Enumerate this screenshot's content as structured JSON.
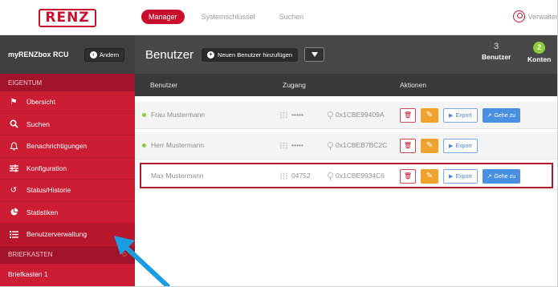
{
  "app": {
    "logo": "RENZ"
  },
  "nav": {
    "items": [
      "Manager",
      "Systemschlüssel",
      "Suchen"
    ],
    "active_index": 0,
    "user_label": "Verwalter"
  },
  "sidebar": {
    "box_title": "myRENZbox RCU",
    "change_label": "Ändern",
    "section_property": "EIGENTUM",
    "items": [
      {
        "label": "Übersicht",
        "icon": "flag-icon"
      },
      {
        "label": "Suchen",
        "icon": "search-icon"
      },
      {
        "label": "Benachrichtigungen",
        "icon": "bell-icon"
      },
      {
        "label": "Konfiguration",
        "icon": "sliders-icon"
      },
      {
        "label": "Status/Historie",
        "icon": "history-icon"
      },
      {
        "label": "Statistiken",
        "icon": "pie-chart-icon"
      },
      {
        "label": "Benutzerverwaltung",
        "icon": "list-icon"
      }
    ],
    "active_index": 6,
    "section_mailbox": "BRIEFKASTEN",
    "mailbox_item": "Briefkasten 1"
  },
  "header": {
    "title": "Benutzer",
    "add_label": "Neuen Benutzer hinzufügen",
    "stats": [
      {
        "value": "3",
        "label": "Benutzer"
      },
      {
        "value": "2",
        "label": "Konten"
      }
    ]
  },
  "table": {
    "columns": [
      "Benutzer",
      "Zugang",
      "Aktionen"
    ],
    "rows": [
      {
        "name": "Frau Mustermann",
        "pin": "•••••",
        "key": "0x1CBE99409A",
        "export": "Export",
        "goto": "Gehe zu",
        "online": true
      },
      {
        "name": "Herr Mustermann",
        "pin": "•••••",
        "key": "0x1CBEB7BC2C",
        "export": "Export",
        "goto": "",
        "online": true
      },
      {
        "name": "Max Mustermann",
        "pin": "04752",
        "key": "0x1CBE9934C6",
        "export": "Export",
        "goto": "Gehe zu",
        "online": false
      }
    ],
    "highlighted_row": 2
  },
  "colors": {
    "brand": "#c8102e",
    "sidebar": "#cc1d35",
    "header": "#484848",
    "accent_blue": "#4a90e2",
    "edit_orange": "#f0a22e",
    "online_green": "#8ccf3a",
    "pointer": "#1a9de0"
  }
}
